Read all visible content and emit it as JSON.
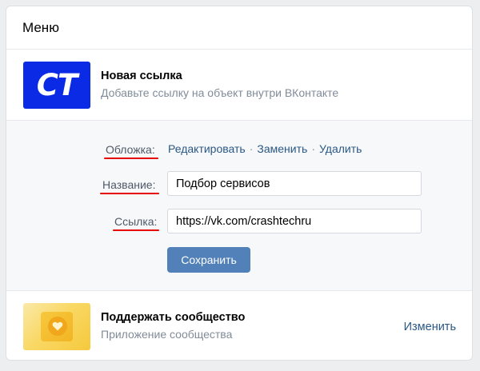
{
  "header": {
    "title": "Меню"
  },
  "new_link": {
    "thumb_text": "CT",
    "title": "Новая ссылка",
    "subtitle": "Добавьте ссылку на объект внутри ВКонтакте"
  },
  "form": {
    "cover_label": "Обложка:",
    "cover_actions": [
      "Редактировать",
      "Заменить",
      "Удалить"
    ],
    "name_label": "Название:",
    "name_value": "Подбор сервисов",
    "link_label": "Ссылка:",
    "link_value": "https://vk.com/crashtechru",
    "save_label": "Сохранить"
  },
  "app_item": {
    "title": "Поддержать сообщество",
    "subtitle": "Приложение сообщества",
    "action": "Изменить"
  },
  "colors": {
    "accent": "#5181b8",
    "link": "#2a5885",
    "highlight_underline": "#e60000",
    "ct_logo_bg": "#0a2ae6"
  }
}
